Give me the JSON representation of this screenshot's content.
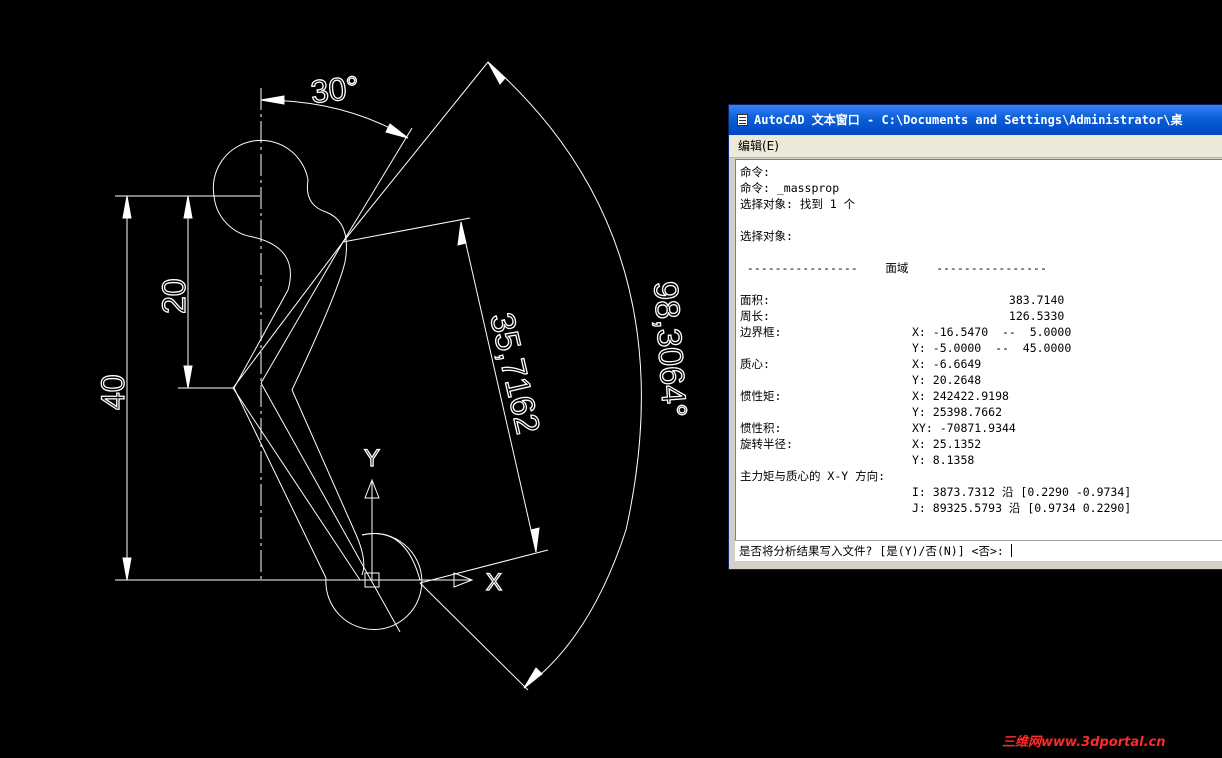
{
  "drawing": {
    "dimensions": {
      "angle_30": "30°",
      "height_20": "20",
      "height_40": "40",
      "length_35": "35,7162",
      "angle_98": "98,3064°"
    },
    "axis": {
      "x_label": "X",
      "y_label": "Y"
    }
  },
  "text_window": {
    "title": "AutoCAD 文本窗口 - C:\\Documents and Settings\\Administrator\\桌",
    "menu": [
      "编辑(E)"
    ],
    "lines": [
      {
        "label": "命令:",
        "value": ""
      },
      {
        "label": "命令: _massprop",
        "value": ""
      },
      {
        "label": "选择对象: 找到 1 个",
        "value": ""
      },
      {
        "label": "",
        "value": ""
      },
      {
        "label": "选择对象:",
        "value": ""
      },
      {
        "label": "",
        "value": ""
      },
      {
        "label": " ----------------    面域    ----------------",
        "value": ""
      },
      {
        "label": "",
        "value": ""
      },
      {
        "label": "面积:",
        "value": "              383.7140"
      },
      {
        "label": "周长:",
        "value": "              126.5330"
      },
      {
        "label": "边界框:",
        "value": "X: -16.5470  --  5.0000"
      },
      {
        "label": "",
        "value": "Y: -5.0000  --  45.0000"
      },
      {
        "label": "质心:",
        "value": "X: -6.6649"
      },
      {
        "label": "",
        "value": "Y: 20.2648"
      },
      {
        "label": "惯性矩:",
        "value": "X: 242422.9198"
      },
      {
        "label": "",
        "value": "Y: 25398.7662"
      },
      {
        "label": "惯性积:",
        "value": "XY: -70871.9344"
      },
      {
        "label": "旋转半径:",
        "value": "X: 25.1352"
      },
      {
        "label": "",
        "value": "Y: 8.1358"
      },
      {
        "label": "主力矩与质心的 X-Y 方向:",
        "value": ""
      },
      {
        "label": "",
        "value": "I: 3873.7312 沿 [0.2290 -0.9734]"
      },
      {
        "label": "",
        "value": "J: 89325.5793 沿 [0.9734 0.2290]"
      }
    ],
    "prompt": "是否将分析结果写入文件? [是(Y)/否(N)] <否>: "
  },
  "watermark": "三维网www.3dportal.cn",
  "colors": {
    "background": "#000000",
    "lines": "#ffffff",
    "titlebar": "#0a5fd8",
    "watermark": "#ff2a2a"
  }
}
